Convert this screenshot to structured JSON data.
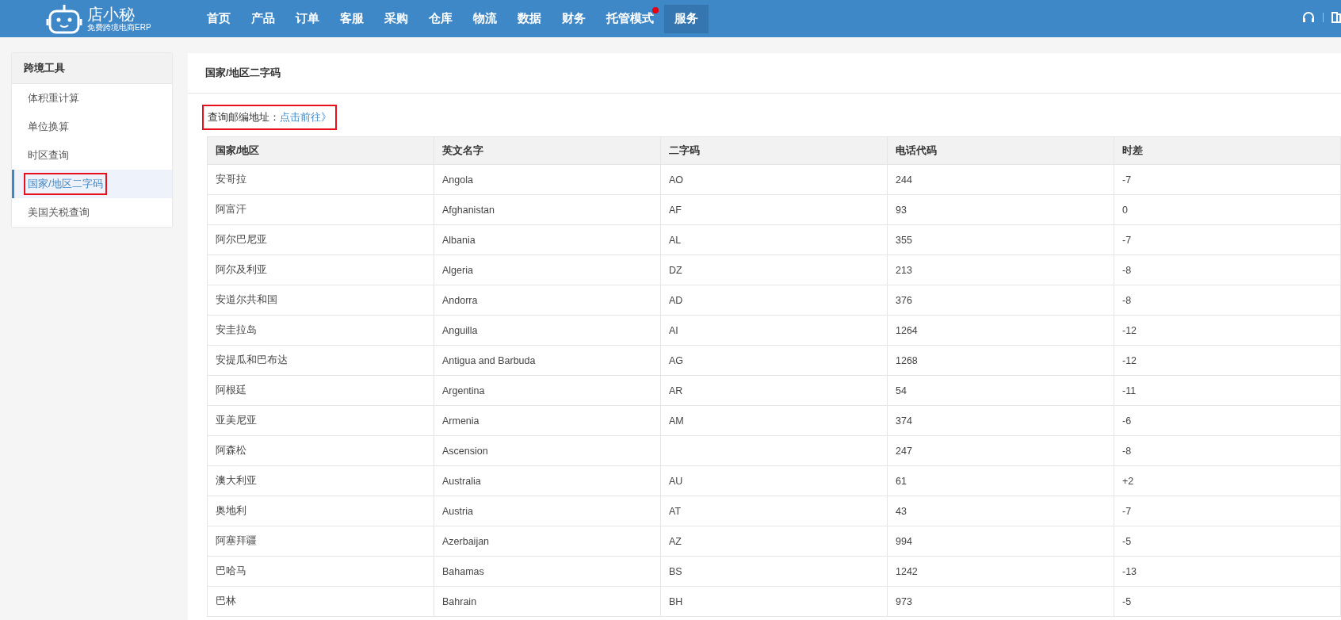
{
  "logo": {
    "name": "店小秘",
    "tagline": "免费跨境电商ERP"
  },
  "nav": [
    {
      "label": "首页",
      "selected": false,
      "badge": false
    },
    {
      "label": "产品",
      "selected": false,
      "badge": false
    },
    {
      "label": "订单",
      "selected": false,
      "badge": false
    },
    {
      "label": "客服",
      "selected": false,
      "badge": false
    },
    {
      "label": "采购",
      "selected": false,
      "badge": false
    },
    {
      "label": "仓库",
      "selected": false,
      "badge": false
    },
    {
      "label": "物流",
      "selected": false,
      "badge": false
    },
    {
      "label": "数据",
      "selected": false,
      "badge": false
    },
    {
      "label": "财务",
      "selected": false,
      "badge": false
    },
    {
      "label": "托管模式",
      "selected": false,
      "badge": true
    },
    {
      "label": "服务",
      "selected": true,
      "badge": false
    }
  ],
  "sidebar": {
    "title": "跨境工具",
    "items": [
      {
        "label": "体积重计算",
        "selected": false,
        "highlighted": false
      },
      {
        "label": "单位换算",
        "selected": false,
        "highlighted": false
      },
      {
        "label": "时区查询",
        "selected": false,
        "highlighted": false
      },
      {
        "label": "国家/地区二字码",
        "selected": true,
        "highlighted": true
      },
      {
        "label": "美国关税查询",
        "selected": false,
        "highlighted": false
      }
    ]
  },
  "page_title": "国家/地区二字码",
  "postcode_link": {
    "label": "查询邮编地址：",
    "link": "点击前往》",
    "highlighted": true
  },
  "table": {
    "columns": [
      "国家/地区",
      "英文名字",
      "二字码",
      "电话代码",
      "时差"
    ],
    "rows": [
      [
        "安哥拉",
        "Angola",
        "AO",
        "244",
        "-7"
      ],
      [
        "阿富汗",
        "Afghanistan",
        "AF",
        "93",
        "0"
      ],
      [
        "阿尔巴尼亚",
        "Albania",
        "AL",
        "355",
        "-7"
      ],
      [
        "阿尔及利亚",
        "Algeria",
        "DZ",
        "213",
        "-8"
      ],
      [
        "安道尔共和国",
        "Andorra",
        "AD",
        "376",
        "-8"
      ],
      [
        "安圭拉岛",
        "Anguilla",
        "AI",
        "1264",
        "-12"
      ],
      [
        "安提瓜和巴布达",
        "Antigua and Barbuda",
        "AG",
        "1268",
        "-12"
      ],
      [
        "阿根廷",
        "Argentina",
        "AR",
        "54",
        "-11"
      ],
      [
        "亚美尼亚",
        "Armenia",
        "AM",
        "374",
        "-6"
      ],
      [
        "阿森松",
        "Ascension",
        "",
        "247",
        "-8"
      ],
      [
        "澳大利亚",
        "Australia",
        "AU",
        "61",
        "+2"
      ],
      [
        "奥地利",
        "Austria",
        "AT",
        "43",
        "-7"
      ],
      [
        "阿塞拜疆",
        "Azerbaijan",
        "AZ",
        "994",
        "-5"
      ],
      [
        "巴哈马",
        "Bahamas",
        "BS",
        "1242",
        "-13"
      ],
      [
        "巴林",
        "Bahrain",
        "BH",
        "973",
        "-5"
      ]
    ]
  }
}
